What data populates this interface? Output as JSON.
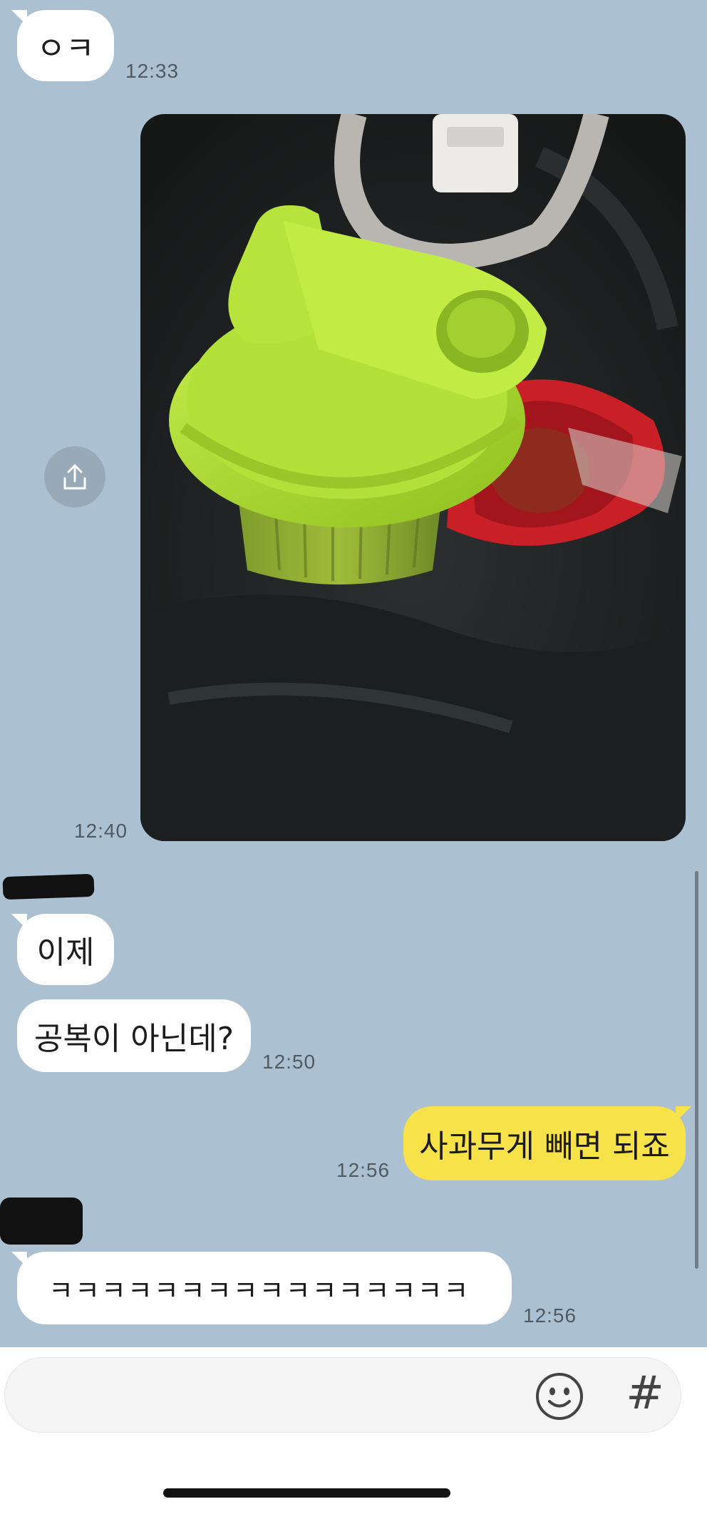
{
  "messages": [
    {
      "text": "ㅇㅋ",
      "time": "12:33"
    },
    {
      "time": "12:40"
    },
    {
      "text": "이제"
    },
    {
      "text": "공복이 아닌데?",
      "time": "12:50"
    },
    {
      "text": "사과무게 빼면 되죠",
      "time": "12:56"
    },
    {
      "text": "ㅋㅋㅋㅋㅋㅋㅋㅋㅋㅋㅋㅋㅋㅋㅋㅋ",
      "time": "12:56"
    }
  ],
  "composer": {
    "input_value": "",
    "emoji_icon": "emoji-smile-icon",
    "hash_label": "#"
  },
  "colors": {
    "chat_background": "#abc1d1",
    "incoming_bubble": "#ffffff",
    "outgoing_bubble": "#f8e24a"
  }
}
